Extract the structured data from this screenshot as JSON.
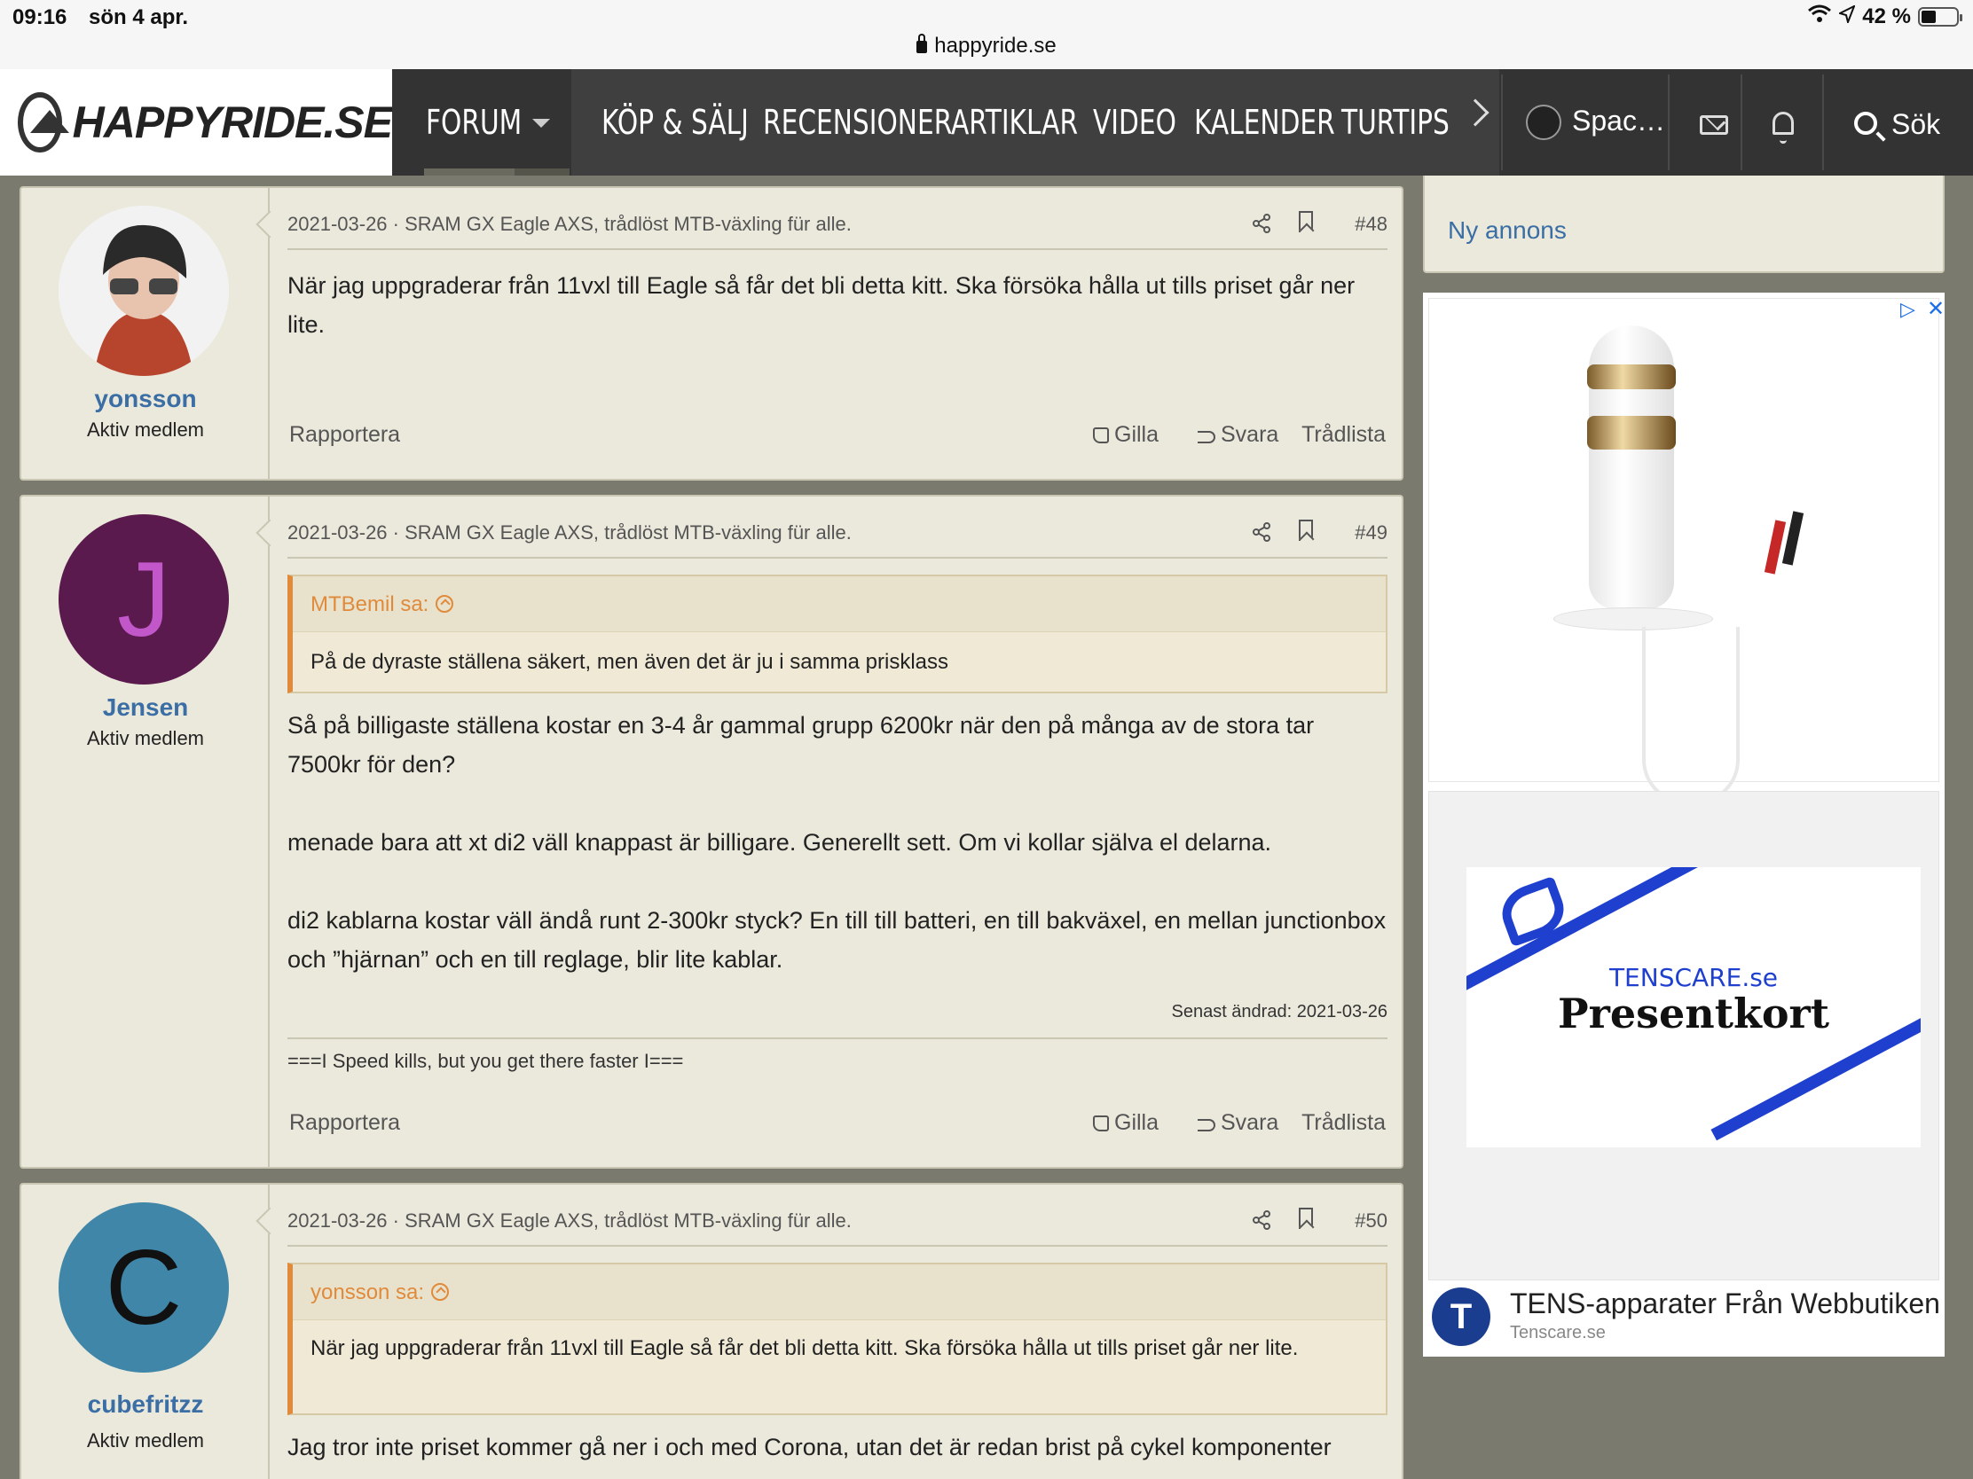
{
  "status_bar": {
    "time": "09:16",
    "date": "sön 4 apr.",
    "url": "happyride.se",
    "battery": "42 %"
  },
  "nav": {
    "logo": "HAPPYRIDE.SE",
    "items": [
      "FORUM",
      "KÖP & SÄLJ",
      "RECENSIONER",
      "ARTIKLAR",
      "VIDEO",
      "KALENDER",
      "TURTIPS"
    ],
    "user": "Spac…",
    "search": "Sök"
  },
  "posts": [
    {
      "username": "yonsson",
      "user_title": "Aktiv medlem",
      "avatar_letter": "",
      "date": "2021-03-26",
      "thread": "SRAM GX Eagle AXS, trådlöst MTB-växling für alle.",
      "number": "#48",
      "message": "När jag uppgraderar från 11vxl till Eagle så får det bli detta kitt. Ska försöka hålla ut tills priset går ner lite.",
      "actions": {
        "report": "Rapportera",
        "like": "Gilla",
        "reply": "Svara",
        "thread_list": "Trådlista"
      }
    },
    {
      "username": "Jensen",
      "user_title": "Aktiv medlem",
      "avatar_letter": "J",
      "avatar_color": "#5a1a4e",
      "letter_color": "#c257c9",
      "date": "2021-03-26",
      "thread": "SRAM GX Eagle AXS, trådlöst MTB-växling für alle.",
      "number": "#49",
      "quote_author": "MTBemil sa:",
      "quote_text": "På de dyraste ställena säkert, men även det är ju i samma prisklass",
      "message_p1": "Så på billigaste ställena kostar en 3-4 år gammal grupp 6200kr när den på många av de stora tar 7500kr för den?",
      "message_p2": "menade bara att xt di2 väll knappast är billigare. Generellt sett. Om vi kollar själva el delarna.",
      "message_p3": "di2 kablarna kostar väll ändå runt 2-300kr styck? En till till batteri, en till bakväxel, en mellan junctionbox och ”hjärnan” och en till reglage, blir lite kablar.",
      "edited": "Senast ändrad: 2021-03-26",
      "signature": "===I Speed kills, but you get there faster I===",
      "actions": {
        "report": "Rapportera",
        "like": "Gilla",
        "reply": "Svara",
        "thread_list": "Trådlista"
      }
    },
    {
      "username": "cubefritzz",
      "user_title": "Aktiv medlem",
      "avatar_letter": "C",
      "avatar_color": "#3f86a8",
      "letter_color": "#111111",
      "date": "2021-03-26",
      "thread": "SRAM GX Eagle AXS, trådlöst MTB-växling für alle.",
      "number": "#50",
      "quote_author": "yonsson sa:",
      "quote_text": "När jag uppgraderar från 11vxl till Eagle så får det bli detta kitt. Ska försöka hålla ut tills priset går ner lite.",
      "message": "Jag tror inte priset kommer gå ner i och med Corona, utan det är redan brist på cykel komponenter"
    }
  ],
  "sidebar": {
    "new_ad_link": "Ny annons",
    "ad": {
      "gift_brand": "TENSCARE.se",
      "gift_title": "Presentkort",
      "footer_logo": "T",
      "footer_title": "TENS-apparater Från Webbutiken",
      "footer_sub": "Tenscare.se"
    }
  }
}
